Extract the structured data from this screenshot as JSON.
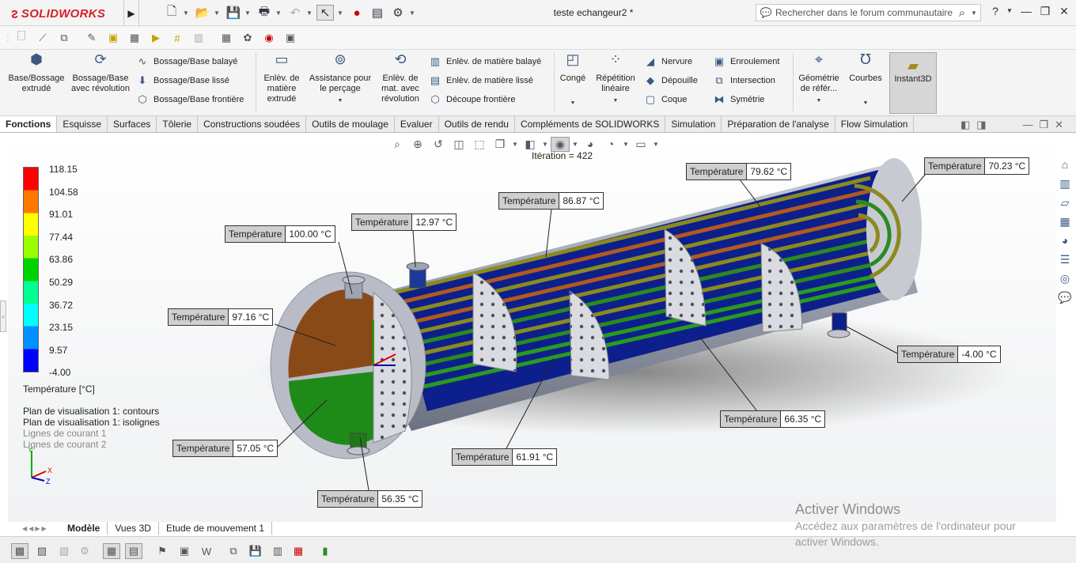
{
  "app": {
    "brand": "SOLIDWORKS",
    "doc_title": "teste echangeur2 *"
  },
  "search": {
    "placeholder": "Rechercher dans le forum communautaire"
  },
  "ribbon": {
    "base_extrude": "Base/Bossage extrudé",
    "base_revolve": "Bossage/Base avec révolution",
    "swept": "Bossage/Base balayé",
    "loft": "Bossage/Base lissé",
    "boundary": "Bossage/Base frontière",
    "cut_extrude": "Enlèv. de matière extrudé",
    "hole_wizard": "Assistance pour le perçage",
    "cut_revolve": "Enlèv. de mat. avec révolution",
    "cut_swept": "Enlèv. de matière balayé",
    "cut_loft": "Enlèv. de matière lissé",
    "cut_boundary": "Découpe frontière",
    "fillet": "Congé",
    "linear_pattern": "Répétition linéaire",
    "rib": "Nervure",
    "draft": "Dépouille",
    "shell": "Coque",
    "wrap": "Enroulement",
    "intersect": "Intersection",
    "mirror": "Symétrie",
    "ref_geometry": "Géométrie de référ...",
    "curves": "Courbes",
    "instant3d": "Instant3D"
  },
  "tabs": [
    "Fonctions",
    "Esquisse",
    "Surfaces",
    "Tôlerie",
    "Constructions soudées",
    "Outils de moulage",
    "Evaluer",
    "Outils de rendu",
    "Compléments de SOLIDWORKS",
    "Simulation",
    "Préparation de l'analyse",
    "Flow Simulation"
  ],
  "iteration": "Itération = 422",
  "legend": {
    "values": [
      "118.15",
      "104.58",
      "91.01",
      "77.44",
      "63.86",
      "50.29",
      "36.72",
      "23.15",
      "9.57",
      "-4.00"
    ],
    "title": "Température [°C]",
    "colors": [
      "#ff0000",
      "#ff7800",
      "#ffff00",
      "#9aff00",
      "#00d200",
      "#00ff90",
      "#00ffff",
      "#0090ff",
      "#0000ff"
    ]
  },
  "plot_notes": [
    "Plan de visualisation 1: contours",
    "Plan de visualisation 1: isolignes",
    "Lignes de courant 1",
    "Lignes de courant 2"
  ],
  "callouts": [
    {
      "label": "Température",
      "value": "100.00 °C"
    },
    {
      "label": "Température",
      "value": "12.97 °C"
    },
    {
      "label": "Température",
      "value": "86.87 °C"
    },
    {
      "label": "Température",
      "value": "79.62 °C"
    },
    {
      "label": "Température",
      "value": "70.23 °C"
    },
    {
      "label": "Température",
      "value": "97.16 °C"
    },
    {
      "label": "Température",
      "value": "-4.00 °C"
    },
    {
      "label": "Température",
      "value": "66.35 °C"
    },
    {
      "label": "Température",
      "value": "57.05 °C"
    },
    {
      "label": "Température",
      "value": "61.91 °C"
    },
    {
      "label": "Température",
      "value": "56.35 °C"
    }
  ],
  "bottom_tabs": [
    "Modèle",
    "Vues 3D",
    "Etude de mouvement 1"
  ],
  "watermark": {
    "title": "Activer Windows",
    "line1": "Accédez aux paramètres de l'ordinateur pour",
    "line2": "activer Windows."
  },
  "axes": {
    "x": "X",
    "y": "Y",
    "z": "Z"
  }
}
